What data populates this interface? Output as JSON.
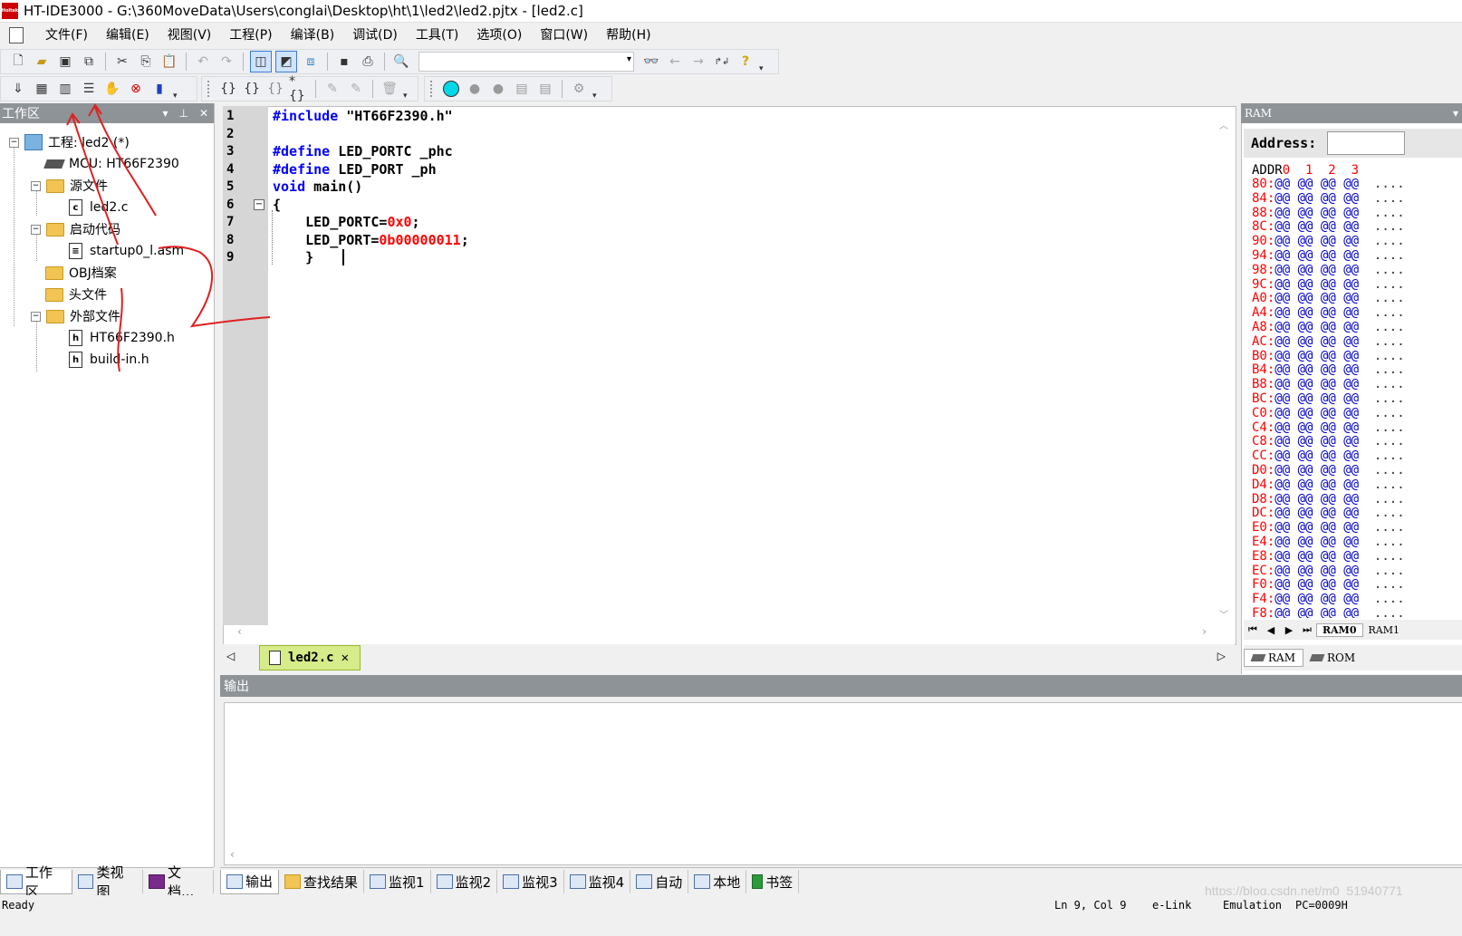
{
  "window": {
    "title": "HT-IDE3000 - G:\\360MoveData\\Users\\conglai\\Desktop\\ht\\1\\led2\\led2.pjtx - [led2.c]",
    "app_icon_text": "Holtek"
  },
  "menu": [
    "文件(F)",
    "编辑(E)",
    "视图(V)",
    "工程(P)",
    "编译(B)",
    "调试(D)",
    "工具(T)",
    "选项(O)",
    "窗口(W)",
    "帮助(H)"
  ],
  "workspace": {
    "title": "工作区",
    "project": "工程: led2 (*)",
    "mcu": "MCU: HT66F2390",
    "source_folder": "源文件",
    "source_file": "led2.c",
    "startup_folder": "启动代码",
    "startup_file": "startup0_l.asm",
    "obj_folder": "OBJ档案",
    "header_folder": "头文件",
    "external_folder": "外部文件",
    "external_files": [
      "HT66F2390.h",
      "build-in.h"
    ]
  },
  "ws_tabs": [
    "工作区",
    "类视图",
    "文档..."
  ],
  "editor": {
    "tab": "led2.c",
    "line_numbers": [
      "1",
      "2",
      "3",
      "4",
      "5",
      "6",
      "7",
      "8",
      "9"
    ],
    "line1": {
      "kw": "#include",
      "rest": " \"HT66F2390.h\""
    },
    "line3": {
      "kw": "#define",
      "rest": " LED_PORTC _phc"
    },
    "line4": {
      "kw": "#define",
      "rest": " LED_PORT _ph"
    },
    "line5": {
      "kw": "void",
      "rest": " main()"
    },
    "line6": "{",
    "line7": {
      "pre": "    LED_PORTC=",
      "num": "0x0",
      "post": ";"
    },
    "line8": {
      "pre": "    LED_PORT=",
      "num": "0b00000011",
      "post": ";"
    },
    "line9": "    }"
  },
  "ram": {
    "title": "RAM",
    "address_label": "Address:",
    "header_addr": "ADDR",
    "header_cols": "0  1  2  3",
    "value": "@@",
    "dots": "....",
    "rows": [
      "80",
      "84",
      "88",
      "8C",
      "90",
      "94",
      "98",
      "9C",
      "A0",
      "A4",
      "A8",
      "AC",
      "B0",
      "B4",
      "B8",
      "BC",
      "C0",
      "C4",
      "C8",
      "CC",
      "D0",
      "D4",
      "D8",
      "DC",
      "E0",
      "E4",
      "E8",
      "EC",
      "F0",
      "F4",
      "F8"
    ],
    "bank_tabs": [
      "RAM0",
      "RAM1"
    ],
    "bottom_tabs": [
      "RAM",
      "ROM"
    ]
  },
  "output": {
    "title": "输出"
  },
  "out_tabs": [
    "输出",
    "查找结果",
    "监视1",
    "监视2",
    "监视3",
    "监视4",
    "自动",
    "本地",
    "书签"
  ],
  "status": {
    "ready": "Ready",
    "pos": "Ln 9, Col 9",
    "link": "e-Link",
    "mode": "Emulation",
    "pc": "PC=0009H"
  },
  "watermark": "https://blog.csdn.net/m0_51940771",
  "colors": {
    "keyword": "#0000ff",
    "number": "#ff0000",
    "ram_addr": "#ff0000",
    "ram_value": "#0000cc",
    "annotation": "#e02020",
    "active_tab": "#d6ec8a"
  }
}
